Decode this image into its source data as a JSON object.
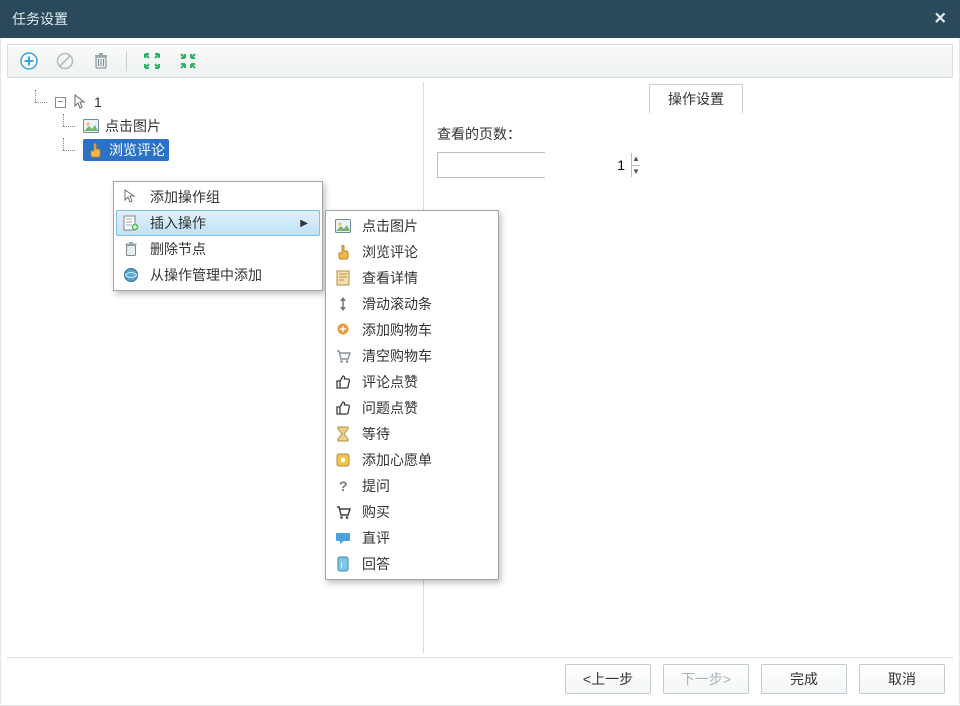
{
  "window": {
    "title": "任务设置",
    "close_glyph": "×"
  },
  "toolbar": {
    "add_name": "add-icon",
    "cancel_name": "cancel-icon",
    "delete_name": "trash-icon",
    "expand_name": "expand-icon",
    "collapse_name": "collapse-icon"
  },
  "tree": {
    "root_label": "1",
    "node_click_img": "点击图片",
    "node_browse_comments": "浏览评论"
  },
  "context_menu": {
    "items": [
      {
        "label": "添加操作组",
        "icon": "cursor-add-icon"
      },
      {
        "label": "插入操作",
        "icon": "insert-action-icon",
        "submenu": true,
        "highlight": true
      },
      {
        "label": "删除节点",
        "icon": "trash-icon"
      },
      {
        "label": "从操作管理中添加",
        "icon": "globe-sync-icon"
      }
    ]
  },
  "submenu": {
    "items": [
      {
        "label": "点击图片",
        "icon": "photo-icon"
      },
      {
        "label": "浏览评论",
        "icon": "hand-point-icon"
      },
      {
        "label": "查看详情",
        "icon": "detail-page-icon"
      },
      {
        "label": "滑动滚动条",
        "icon": "scroll-icon"
      },
      {
        "label": "添加购物车",
        "icon": "cart-add-icon"
      },
      {
        "label": "清空购物车",
        "icon": "cart-clear-icon"
      },
      {
        "label": "评论点赞",
        "icon": "thumb-up-icon"
      },
      {
        "label": "问题点赞",
        "icon": "thumb-up-icon"
      },
      {
        "label": "等待",
        "icon": "hourglass-icon"
      },
      {
        "label": "添加心愿单",
        "icon": "wishlist-icon"
      },
      {
        "label": "提问",
        "icon": "question-icon"
      },
      {
        "label": "购买",
        "icon": "buy-cart-icon"
      },
      {
        "label": "直评",
        "icon": "chat-bubble-icon"
      },
      {
        "label": "回答",
        "icon": "answer-icon"
      }
    ]
  },
  "right_pane": {
    "tab_label": "操作设置",
    "field_label": "查看的页数：",
    "field_value": "1"
  },
  "footer": {
    "prev": "<上一步",
    "next": "下一步>",
    "finish": "完成",
    "cancel": "取消"
  }
}
